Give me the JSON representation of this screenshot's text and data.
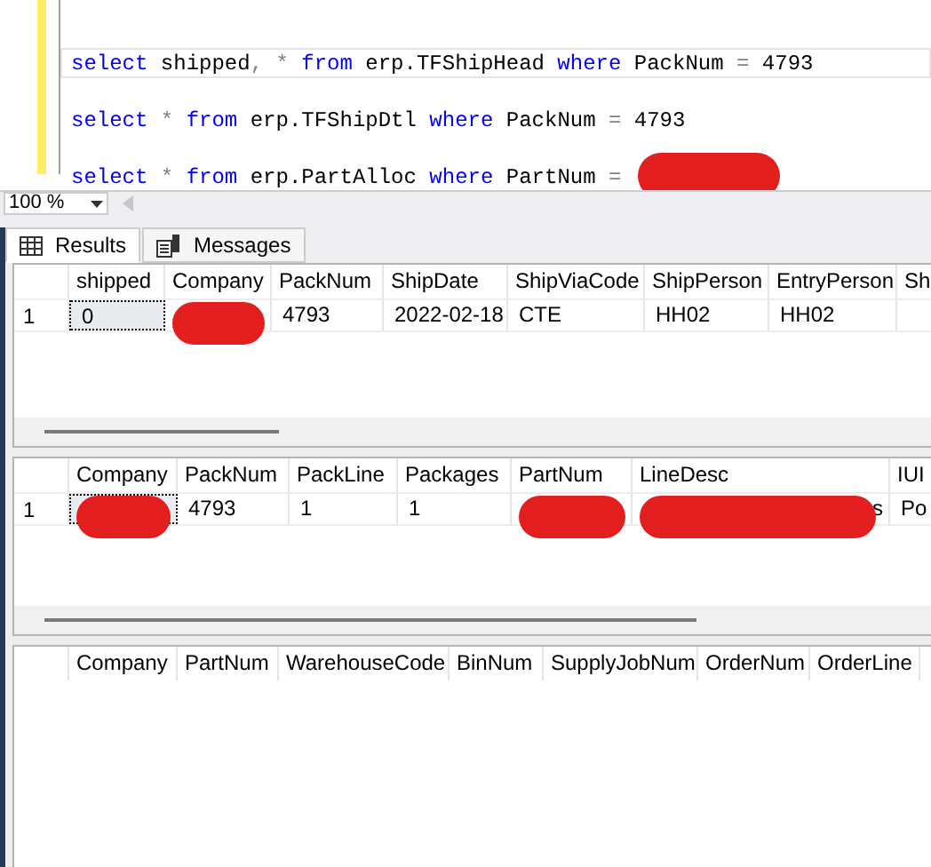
{
  "editor": {
    "lines": [
      {
        "current": true,
        "redaction": false,
        "tokens": [
          {
            "text": "select",
            "kind": "keyword"
          },
          {
            "text": " shipped",
            "kind": "plain"
          },
          {
            "text": ",",
            "kind": "operator"
          },
          {
            "text": " *",
            "kind": "operator"
          },
          {
            "text": " from",
            "kind": "keyword"
          },
          {
            "text": " erp.TFShipHead",
            "kind": "plain"
          },
          {
            "text": " where",
            "kind": "keyword"
          },
          {
            "text": " PackNum",
            "kind": "plain"
          },
          {
            "text": " =",
            "kind": "operator"
          },
          {
            "text": " 4793",
            "kind": "plain"
          }
        ]
      },
      {
        "current": false,
        "redaction": false,
        "tokens": [
          {
            "text": "select",
            "kind": "keyword"
          },
          {
            "text": " *",
            "kind": "operator"
          },
          {
            "text": " from",
            "kind": "keyword"
          },
          {
            "text": " erp.TFShipDtl",
            "kind": "plain"
          },
          {
            "text": " where",
            "kind": "keyword"
          },
          {
            "text": " PackNum",
            "kind": "plain"
          },
          {
            "text": " =",
            "kind": "operator"
          },
          {
            "text": " 4793",
            "kind": "plain"
          }
        ]
      },
      {
        "current": false,
        "redaction": true,
        "tokens": [
          {
            "text": "select",
            "kind": "keyword"
          },
          {
            "text": " *",
            "kind": "operator"
          },
          {
            "text": " from",
            "kind": "keyword"
          },
          {
            "text": " erp.PartAlloc",
            "kind": "plain"
          },
          {
            "text": " where",
            "kind": "keyword"
          },
          {
            "text": " PartNum",
            "kind": "plain"
          },
          {
            "text": " =",
            "kind": "operator"
          }
        ]
      }
    ]
  },
  "zoom": {
    "value": "100 %"
  },
  "tabs": [
    {
      "label": "Results",
      "selected": true,
      "kind": "grid"
    },
    {
      "label": "Messages",
      "selected": false,
      "kind": "messages"
    }
  ],
  "grids": [
    {
      "columns": [
        "shipped",
        "Company",
        "PackNum",
        "ShipDate",
        "ShipViaCode",
        "ShipPerson",
        "EntryPerson",
        "Sh"
      ],
      "rows": [
        {
          "number": "1",
          "cells": [
            {
              "text": "0",
              "selected": true,
              "redacted": false
            },
            {
              "text": "",
              "selected": false,
              "redacted": true
            },
            {
              "text": "4793",
              "selected": false,
              "redacted": false
            },
            {
              "text": "2022-02-18",
              "selected": false,
              "redacted": false
            },
            {
              "text": "CTE",
              "selected": false,
              "redacted": false
            },
            {
              "text": "HH02",
              "selected": false,
              "redacted": false
            },
            {
              "text": "HH02",
              "selected": false,
              "redacted": false
            }
          ]
        }
      ]
    },
    {
      "columns": [
        "Company",
        "PackNum",
        "PackLine",
        "Packages",
        "PartNum",
        "LineDesc",
        "IUI"
      ],
      "rows": [
        {
          "number": "1",
          "cells": [
            {
              "text": "",
              "selected": true,
              "redacted": true
            },
            {
              "text": "4793",
              "selected": false,
              "redacted": false
            },
            {
              "text": "1",
              "selected": false,
              "redacted": false
            },
            {
              "text": "1",
              "selected": false,
              "redacted": false
            },
            {
              "text": "",
              "selected": false,
              "redacted": true
            },
            {
              "text": "s",
              "selected": false,
              "redacted": true
            },
            {
              "text": "Po",
              "selected": false,
              "redacted": false
            }
          ]
        }
      ]
    },
    {
      "columns": [
        "Company",
        "PartNum",
        "WarehouseCode",
        "BinNum",
        "SupplyJobNum",
        "OrderNum",
        "OrderLine"
      ]
    }
  ]
}
